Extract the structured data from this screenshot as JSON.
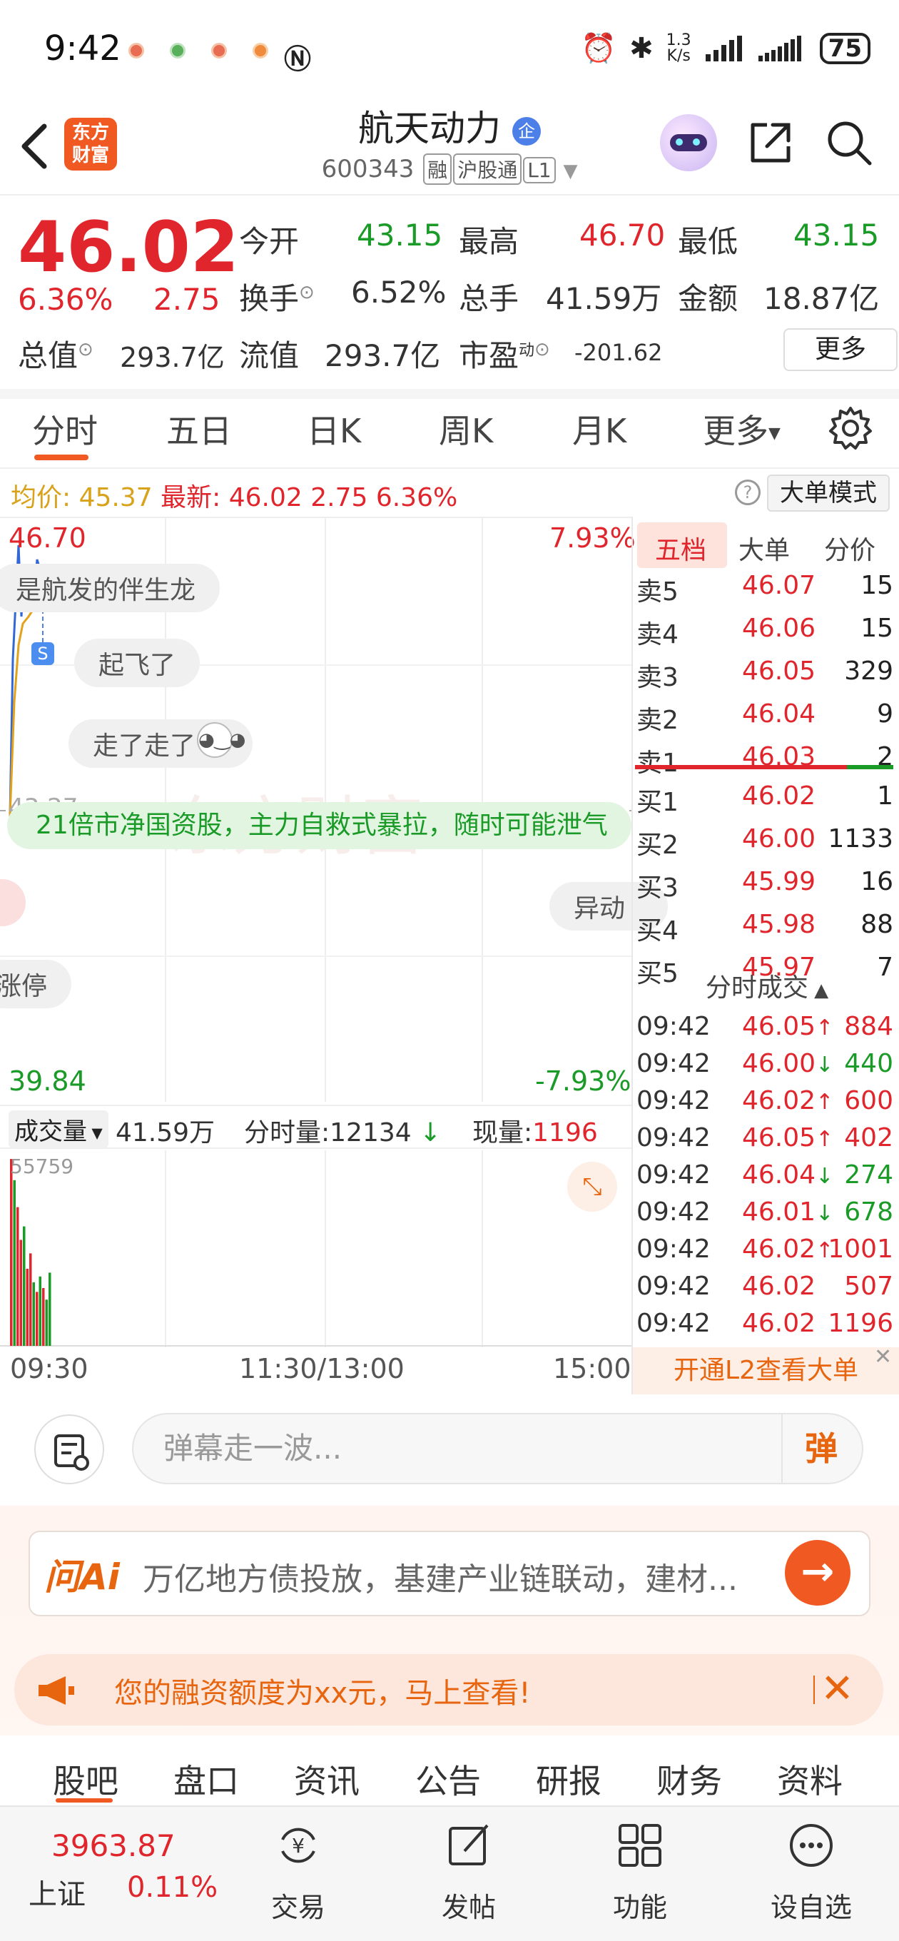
{
  "status": {
    "time": "9:42",
    "net_speed": "1.3\nK/s",
    "net_top": "1.3",
    "net_bottom": "K/s",
    "battery": "75"
  },
  "header": {
    "logo_line1": "东方",
    "logo_line2": "财富",
    "stock_name": "航天动力",
    "badge": "企",
    "code": "600343",
    "tag1": "融",
    "tag2": "沪股通",
    "tag3": "L1"
  },
  "quote": {
    "price": "46.02",
    "pct": "6.36%",
    "change": "2.75",
    "open_label": "今开",
    "open": "43.15",
    "high_label": "最高",
    "high": "46.70",
    "low_label": "最低",
    "low": "43.15",
    "turnover_label": "换手",
    "turnover": "6.52%",
    "volume_label": "总手",
    "volume": "41.59万",
    "amount_label": "金额",
    "amount": "18.87亿",
    "mcap_label": "总值",
    "mcap": "293.7亿",
    "float_label": "流值",
    "float": "293.7亿",
    "pe_label": "市盈",
    "pe_sup": "动",
    "pe": "-201.62",
    "more": "更多"
  },
  "tabs": [
    "分时",
    "五日",
    "日K",
    "周K",
    "月K",
    "更多"
  ],
  "avg_row": {
    "avg_label": "均价:",
    "avg": "45.37",
    "latest_label": "最新:",
    "latest": "46.02",
    "chg": "2.75",
    "pct": "6.36%"
  },
  "bigorder_mode": "大单模式",
  "chart": {
    "high": "46.70",
    "high_pct": "7.93%",
    "low": "39.84",
    "low_pct": "-7.93%",
    "mid_label": "43.27",
    "watermark": "东方财富"
  },
  "danmaku": {
    "b1": "是航发的伴生龙",
    "b2": "起飞了",
    "b3": "走了走了",
    "banner": "21倍市净国资股，主力自救式暴拉，随时可能泄气",
    "b4": "异动",
    "b5": "涨停"
  },
  "volume": {
    "select": "成交量",
    "total": "41.59万",
    "period_label": "分时量:",
    "period": "12134",
    "current_label": "现量:",
    "current": "1196",
    "max": "55759"
  },
  "volume_bars": [
    {
      "h": 0.97,
      "c": "#e0262c"
    },
    {
      "h": 0.86,
      "c": "#1a9a27"
    },
    {
      "h": 0.72,
      "c": "#e0262c"
    },
    {
      "h": 0.55,
      "c": "#e0262c"
    },
    {
      "h": 0.62,
      "c": "#1a9a27"
    },
    {
      "h": 0.4,
      "c": "#e0262c"
    },
    {
      "h": 0.48,
      "c": "#e0262c"
    },
    {
      "h": 0.33,
      "c": "#1a9a27"
    },
    {
      "h": 0.28,
      "c": "#e0262c"
    },
    {
      "h": 0.36,
      "c": "#1a9a27"
    },
    {
      "h": 0.3,
      "c": "#e0262c"
    },
    {
      "h": 0.24,
      "c": "#1a9a27"
    },
    {
      "h": 0.38,
      "c": "#1a9a27"
    }
  ],
  "time_axis": {
    "start": "09:30",
    "mid": "11:30/13:00",
    "end": "15:00"
  },
  "orderbook": {
    "tabs": [
      "五档",
      "大单",
      "分价"
    ],
    "asks": [
      {
        "label": "卖5",
        "price": "46.07",
        "vol": "15"
      },
      {
        "label": "卖4",
        "price": "46.06",
        "vol": "15"
      },
      {
        "label": "卖3",
        "price": "46.05",
        "vol": "329"
      },
      {
        "label": "卖2",
        "price": "46.04",
        "vol": "9"
      },
      {
        "label": "卖1",
        "price": "46.03",
        "vol": "2"
      }
    ],
    "bids": [
      {
        "label": "买1",
        "price": "46.02",
        "vol": "1"
      },
      {
        "label": "买2",
        "price": "46.00",
        "vol": "1133"
      },
      {
        "label": "买3",
        "price": "45.99",
        "vol": "16"
      },
      {
        "label": "买4",
        "price": "45.98",
        "vol": "88"
      },
      {
        "label": "买5",
        "price": "45.97",
        "vol": "7"
      }
    ]
  },
  "trades": {
    "title": "分时成交",
    "rows": [
      {
        "time": "09:42",
        "price": "46.05",
        "dir": "↑",
        "vol": "884",
        "color": "#e0262c"
      },
      {
        "time": "09:42",
        "price": "46.00",
        "dir": "↓",
        "vol": "440",
        "color": "#1a9a27"
      },
      {
        "time": "09:42",
        "price": "46.02",
        "dir": "↑",
        "vol": "600",
        "color": "#e0262c"
      },
      {
        "time": "09:42",
        "price": "46.05",
        "dir": "↑",
        "vol": "402",
        "color": "#e0262c"
      },
      {
        "time": "09:42",
        "price": "46.04",
        "dir": "↓",
        "vol": "274",
        "color": "#1a9a27"
      },
      {
        "time": "09:42",
        "price": "46.01",
        "dir": "↓",
        "vol": "678",
        "color": "#1a9a27"
      },
      {
        "time": "09:42",
        "price": "46.02",
        "dir": "↑",
        "vol": "1001",
        "color": "#e0262c"
      },
      {
        "time": "09:42",
        "price": "46.02",
        "dir": "",
        "vol": "507",
        "color": "#e0262c"
      },
      {
        "time": "09:42",
        "price": "46.02",
        "dir": "",
        "vol": "1196",
        "color": "#e0262c"
      }
    ]
  },
  "l2_banner": "开通L2查看大单",
  "input": {
    "placeholder": "弹幕走一波...",
    "send": "弹"
  },
  "ai": {
    "logo": "问Ai",
    "text": "万亿地方债投放，基建产业链联动，建材..."
  },
  "notice": {
    "text": "您的融资额度为xx元，马上查看!"
  },
  "section_tabs": [
    "股吧",
    "盘口",
    "资讯",
    "公告",
    "研报",
    "财务",
    "资料"
  ],
  "bottom_nav": {
    "index_value": "3963.87",
    "index_name": "上证",
    "index_pct": "0.11%",
    "items": [
      "交易",
      "发帖",
      "功能",
      "设自选"
    ]
  }
}
